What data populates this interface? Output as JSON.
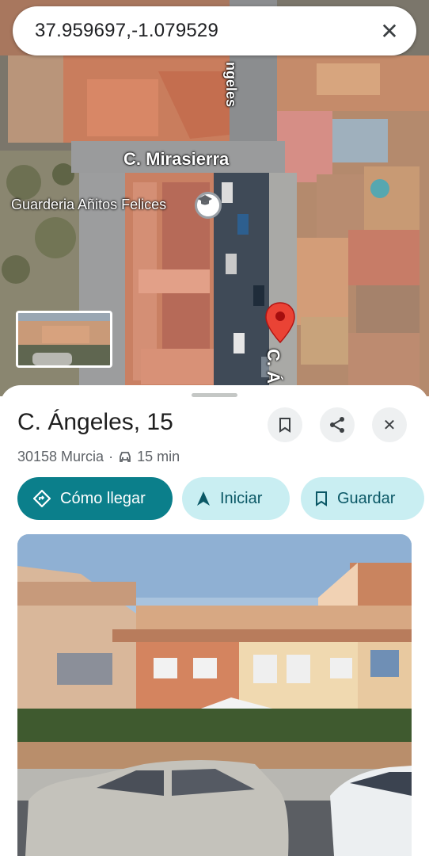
{
  "search": {
    "value": "37.959697,-1.079529",
    "clear_icon": "close-icon"
  },
  "map": {
    "streets": {
      "mirasierra": "C. Mirasierra",
      "angeles_top": "ngeles",
      "angeles_bottom": "C. Á"
    },
    "poi": {
      "label": "Guarderia Añitos Felices",
      "icon": "school-icon"
    },
    "marker": {
      "icon": "map-pin-icon",
      "color": "#ea4335"
    }
  },
  "place": {
    "title": "C. Ángeles, 15",
    "locality": "30158 Murcia",
    "separator": "·",
    "travel_icon": "car-icon",
    "travel_time": "15 min",
    "actions": {
      "directions": "Cómo llegar",
      "start": "Iniciar",
      "save": "Guardar"
    }
  },
  "colors": {
    "primary": "#0b7f8b",
    "tonal": "#c9eef2",
    "on_tonal": "#0b5866"
  }
}
